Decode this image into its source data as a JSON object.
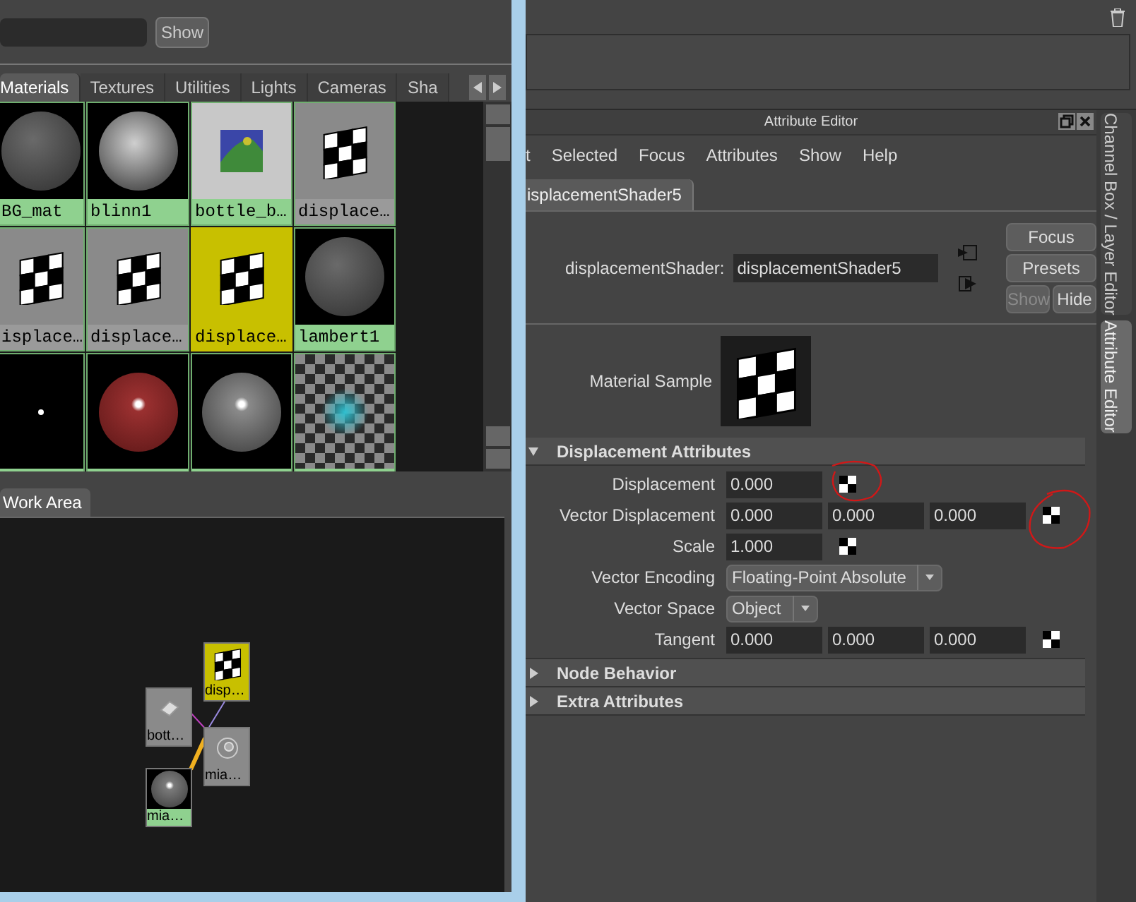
{
  "shelf": {
    "show_button": "Show"
  },
  "tabs": [
    {
      "label": "Materials",
      "selected": true
    },
    {
      "label": "Textures",
      "selected": false
    },
    {
      "label": "Utilities",
      "selected": false
    },
    {
      "label": "Lights",
      "selected": false
    },
    {
      "label": "Cameras",
      "selected": false
    },
    {
      "label": "Sha",
      "selected": false
    }
  ],
  "swatches": [
    {
      "label": "BG_mat",
      "kind": "sphere-dark",
      "color": "#8fd18f",
      "selected": false
    },
    {
      "label": "blinn1",
      "kind": "sphere-light",
      "color": "#8fd18f",
      "selected": false
    },
    {
      "label": "bottle_b…",
      "kind": "image",
      "color": "#8fd18f",
      "selected": false
    },
    {
      "label": "displace…",
      "kind": "checker",
      "color": "#9a9a9a",
      "selected": false
    },
    {
      "label": "isplace…",
      "kind": "checker",
      "color": "#9a9a9a",
      "selected": false
    },
    {
      "label": "displace…",
      "kind": "checker",
      "color": "#9a9a9a",
      "selected": false
    },
    {
      "label": "displace…",
      "kind": "checker",
      "color": "#c8c000",
      "selected": true
    },
    {
      "label": "lambert1",
      "kind": "sphere-dark",
      "color": "#8fd18f",
      "selected": false
    },
    {
      "kind": "dot",
      "color": "#8fd18f",
      "selected": false
    },
    {
      "kind": "sphere-red",
      "color": "#8fd18f",
      "selected": false
    },
    {
      "kind": "sphere-grey",
      "color": "#8fd18f",
      "selected": false
    },
    {
      "kind": "particle",
      "color": "#8fd18f",
      "selected": false
    }
  ],
  "work_area": {
    "tab": "Work Area",
    "nodes": [
      {
        "label": "disp…",
        "kind": "checker",
        "color": "#c8c000"
      },
      {
        "label": "bott…",
        "kind": "texture",
        "color": "#8a8a8a"
      },
      {
        "label": "mia…",
        "kind": "shading",
        "color": "#8a8a8a"
      },
      {
        "label": "mia…",
        "kind": "sphere",
        "color": "#8fd18f"
      }
    ]
  },
  "attribute_editor": {
    "title": "Attribute Editor",
    "menu": [
      "t",
      "Selected",
      "Focus",
      "Attributes",
      "Show",
      "Help"
    ],
    "node_tab": "isplacementShader5",
    "node_label": "displacementShader:",
    "node_name": "displacementShader5",
    "buttons": [
      {
        "label": "Focus",
        "disabled": false
      },
      {
        "label": "Presets",
        "disabled": false
      },
      {
        "label": "Show",
        "disabled": true
      },
      {
        "label": "Hide",
        "disabled": false
      }
    ],
    "sample_label": "Material Sample",
    "sections": [
      {
        "title": "Displacement Attributes",
        "expanded": true,
        "rows": [
          {
            "kind": "fields",
            "label": "Displacement",
            "values": [
              "0.000"
            ],
            "mappable": true
          },
          {
            "kind": "fields",
            "label": "Vector Displacement",
            "values": [
              "0.000",
              "0.000",
              "0.000"
            ],
            "mappable": true
          },
          {
            "kind": "fields",
            "label": "Scale",
            "values": [
              "1.000"
            ],
            "mappable": true
          },
          {
            "kind": "dropdown",
            "label": "Vector Encoding",
            "value": "Floating-Point Absolute"
          },
          {
            "kind": "dropdown",
            "label": "Vector Space",
            "value": "Object"
          },
          {
            "kind": "fields",
            "label": "Tangent",
            "values": [
              "0.000",
              "0.000",
              "0.000"
            ],
            "mappable": true
          }
        ]
      },
      {
        "title": "Node Behavior",
        "expanded": false
      },
      {
        "title": "Extra Attributes",
        "expanded": false
      }
    ]
  },
  "side_tabs": [
    {
      "label": "Channel Box / Layer Editor",
      "selected": false
    },
    {
      "label": "Attribute Editor",
      "selected": true
    }
  ]
}
